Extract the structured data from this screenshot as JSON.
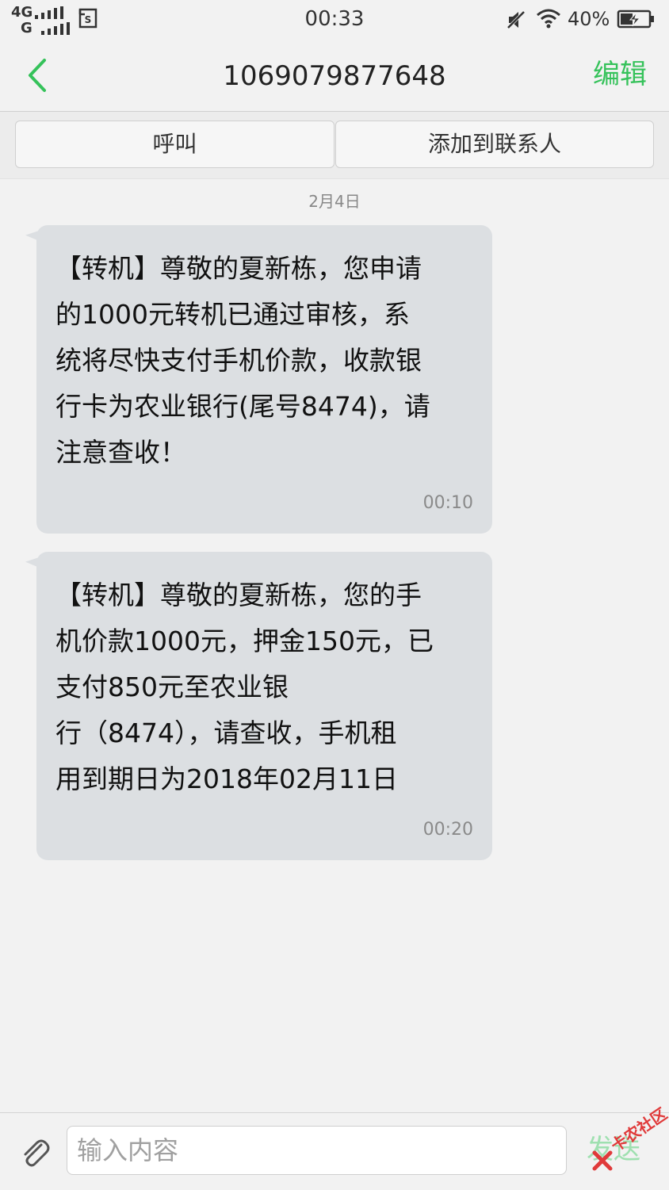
{
  "status_bar": {
    "signal1_label": "4G",
    "signal2_label": "G",
    "time": "00:33",
    "battery": "40%",
    "icons": [
      "signal-icon",
      "sim-icon",
      "mute-icon",
      "wifi-icon",
      "battery-charging-icon"
    ]
  },
  "header": {
    "title": "1069079877648",
    "edit_label": "编辑",
    "back_icon": "chevron-left-icon"
  },
  "actions": {
    "call_label": "呼叫",
    "add_contact_label": "添加到联系人"
  },
  "conversation": {
    "date": "2月4日",
    "messages": [
      {
        "text": "【转机】尊敬的夏新栋，您申请\n的1000元转机已通过审核，系\n统将尽快支付手机价款，收款银\n行卡为农业银行(尾号8474)，请\n注意查收！",
        "time": "00:10"
      },
      {
        "text": "【转机】尊敬的夏新栋，您的手\n机价款1000元，押金150元，已\n支付850元至农业银\n行（8474），请查收，手机租\n用到期日为2018年02月11日",
        "time": "00:20"
      }
    ]
  },
  "compose": {
    "placeholder": "输入内容",
    "value": "",
    "send_label": "发送",
    "attach_icon": "paperclip-icon"
  },
  "watermark": {
    "text": "卡农社区"
  },
  "colors": {
    "accent": "#35c25a",
    "send_disabled": "#9fe0b0",
    "bubble": "#dcdfe2",
    "background": "#f2f2f2"
  }
}
